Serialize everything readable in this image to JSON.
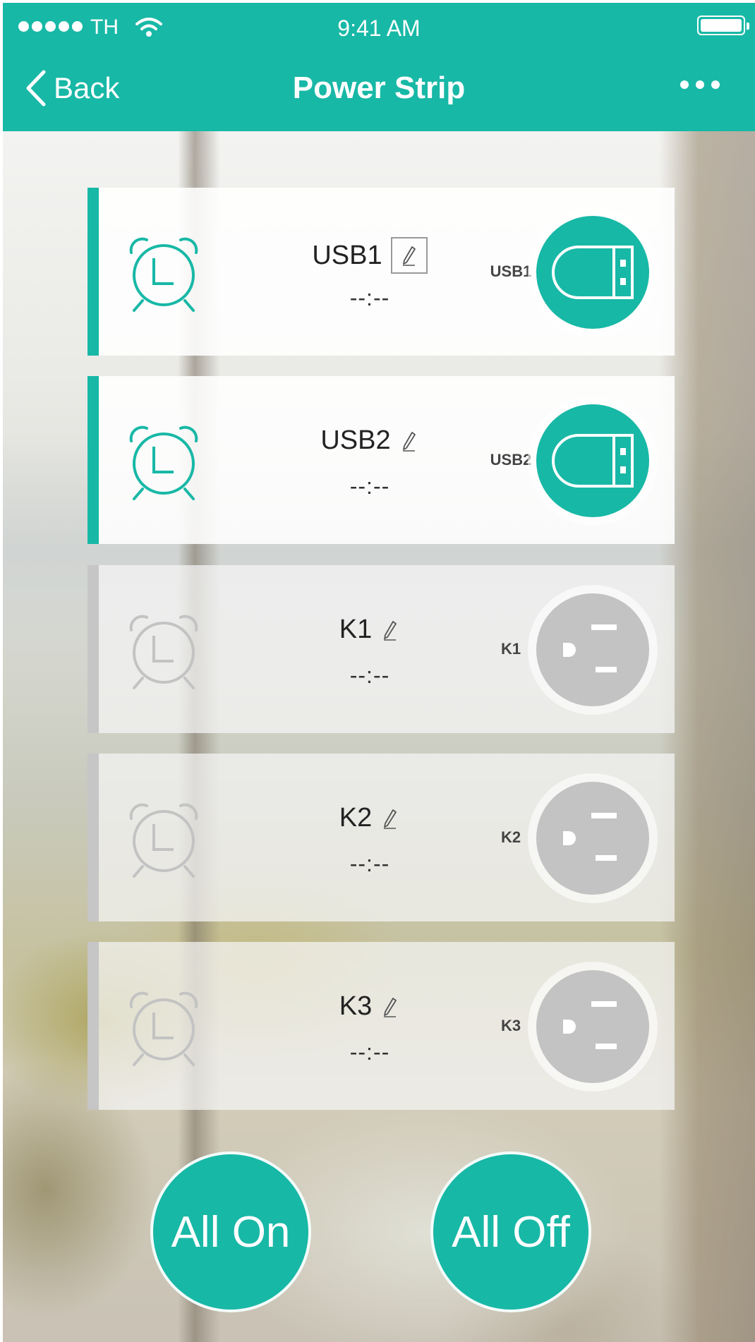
{
  "status_bar": {
    "carrier": "TH",
    "time": "9:41 AM"
  },
  "nav": {
    "back_label": "Back",
    "title": "Power Strip"
  },
  "colors": {
    "accent": "#18b8a6",
    "inactive": "#c3c3c3"
  },
  "outlets": [
    {
      "name": "USB1",
      "timer": "--:--",
      "label": "USB1",
      "icon": "usb-icon",
      "state": "on"
    },
    {
      "name": "USB2",
      "timer": "--:--",
      "label": "USB2",
      "icon": "usb-icon",
      "state": "on"
    },
    {
      "name": "K1",
      "timer": "--:--",
      "label": "K1",
      "icon": "outlet-icon",
      "state": "off"
    },
    {
      "name": "K2",
      "timer": "--:--",
      "label": "K2",
      "icon": "outlet-icon",
      "state": "off"
    },
    {
      "name": "K3",
      "timer": "--:--",
      "label": "K3",
      "icon": "outlet-icon",
      "state": "off"
    }
  ],
  "actions": {
    "all_on": "All On",
    "all_off": "All Off"
  }
}
